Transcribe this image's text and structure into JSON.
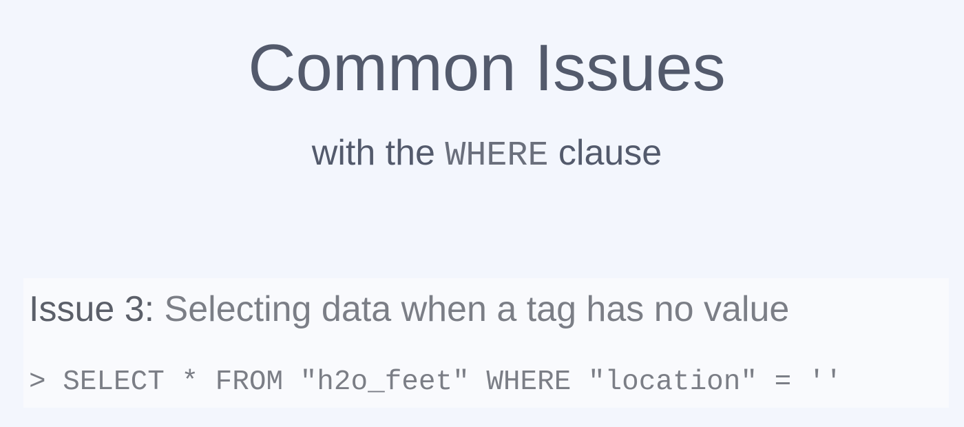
{
  "slide": {
    "title": "Common Issues",
    "subtitle": {
      "prefix": "with the ",
      "keyword": "WHERE",
      "suffix": " clause"
    },
    "issue": {
      "label": "Issue 3:",
      "description": " Selecting data when a tag has no value"
    },
    "query": {
      "prompt": "> ",
      "text": "SELECT * FROM \"h2o_feet\" WHERE \"location\" = ''"
    }
  }
}
